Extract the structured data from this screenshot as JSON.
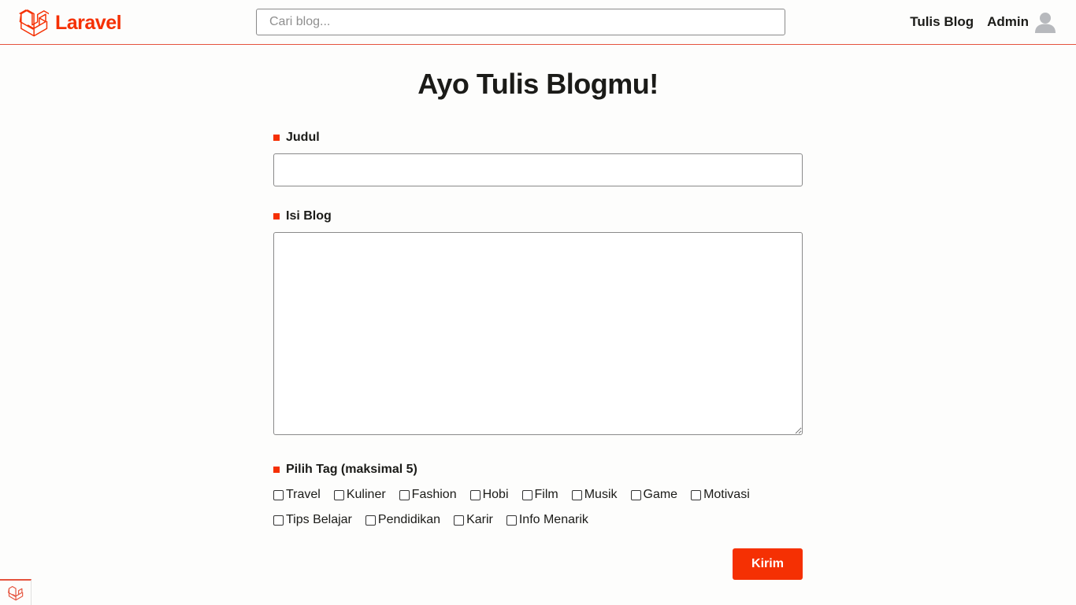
{
  "navbar": {
    "brand": "Laravel",
    "search_placeholder": "Cari blog...",
    "write_link": "Tulis Blog",
    "user_name": "Admin"
  },
  "page": {
    "title": "Ayo Tulis Blogmu!"
  },
  "form": {
    "title_label": "Judul",
    "title_value": "",
    "content_label": "Isi Blog",
    "content_value": "",
    "tags_label": "Pilih Tag (maksimal 5)",
    "tags_row1": [
      "Travel",
      "Kuliner",
      "Fashion",
      "Hobi",
      "Film",
      "Musik",
      "Game",
      "Motivasi"
    ],
    "tags_row2": [
      "Tips Belajar",
      "Pendidikan",
      "Karir",
      "Info Menarik"
    ],
    "submit_label": "Kirim"
  },
  "colors": {
    "accent": "#f53003",
    "border_accent": "#e5533d",
    "background": "#fdfdfc",
    "text": "#1b1b18"
  },
  "icons": {
    "logo": "laravel-logo-icon",
    "avatar": "user-avatar-icon",
    "corner": "laravel-corner-icon"
  }
}
